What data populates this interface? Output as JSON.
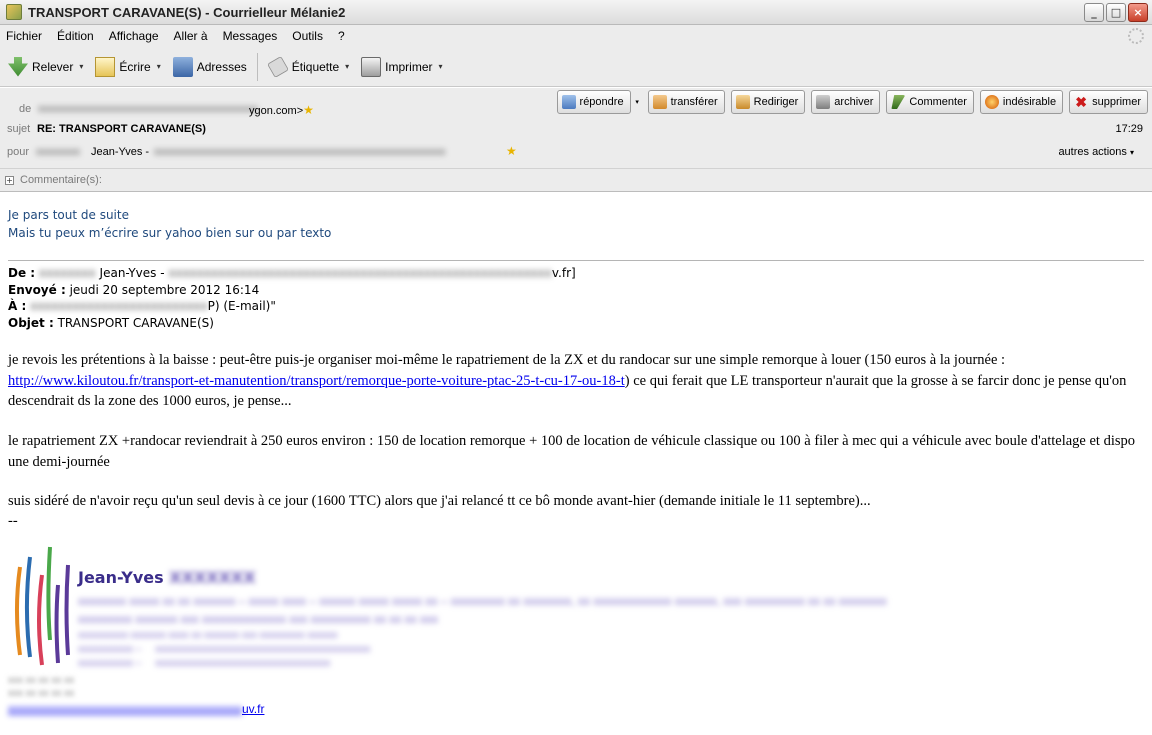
{
  "window": {
    "title": "TRANSPORT CARAVANE(S) - Courrielleur Mélanie2",
    "controls": [
      "_",
      "□",
      "×"
    ]
  },
  "menu": [
    "Fichier",
    "Édition",
    "Affichage",
    "Aller à",
    "Messages",
    "Outils",
    "?"
  ],
  "toolbar": {
    "get": "Relever",
    "write": "Écrire",
    "address": "Adresses",
    "tag": "Étiquette",
    "print": "Imprimer"
  },
  "header": {
    "from_label": "de",
    "from_value": "ygon.com>",
    "subject_label": "sujet",
    "subject_value": "RE: TRANSPORT CARAVANE(S)",
    "to_label": "pour",
    "to_value": "Jean-Yves -",
    "time": "17:29",
    "other_actions": "autres actions",
    "actions": {
      "reply": "répondre",
      "forward": "transférer",
      "redirect": "Rediriger",
      "archive": "archiver",
      "comment": "Commenter",
      "junk": "indésirable",
      "delete": "supprimer"
    },
    "comments_label": "Commentaire(s):"
  },
  "body": {
    "reply_line1": "Je pars tout de suite",
    "reply_line2": "Mais tu peux m’écrire sur yahoo bien sur ou par texto",
    "fwd_de_label": "De :",
    "fwd_de_value": "Jean-Yves -",
    "fwd_de_tail": "v.fr]",
    "fwd_envoye_label": "Envoyé :",
    "fwd_envoye_value": "jeudi 20 septembre 2012 16:14",
    "fwd_a_label": "À :",
    "fwd_a_tail": "P) (E-mail)\"",
    "fwd_objet_label": "Objet :",
    "fwd_objet_value": "TRANSPORT CARAVANE(S)",
    "p1_start": "je revois les prétentions à la baisse : peut-être puis-je organiser moi-même le rapatriement de la ZX et du randocar sur une simple remorque à louer (150 euros à la journée :",
    "p1_link": "http://www.kiloutou.fr/transport-et-manutention/transport/remorque-porte-voiture-ptac-25-t-cu-17-ou-18-t",
    "p1_end": ") ce qui ferait que LE transporteur n'aurait que la grosse à se farcir donc je pense qu'on descendrait ds la zone des 1000 euros, je pense...",
    "p2": "le rapatriement ZX  +randocar reviendrait à 250 euros environ : 150 de location remorque + 100 de location de véhicule classique  ou 100 à filer à mec qui a véhicule avec boule d'attelage et dispo une demi-journée",
    "p3": "suis sidéré de n'avoir reçu qu'un seul devis à ce jour (1600 TTC) alors que j'ai relancé tt ce bô monde avant-hier (demande initiale le 11 septembre)...",
    "sig_dash": "--",
    "sig_name": "Jean-Yves",
    "sig_mail_tail": "uv.fr"
  }
}
